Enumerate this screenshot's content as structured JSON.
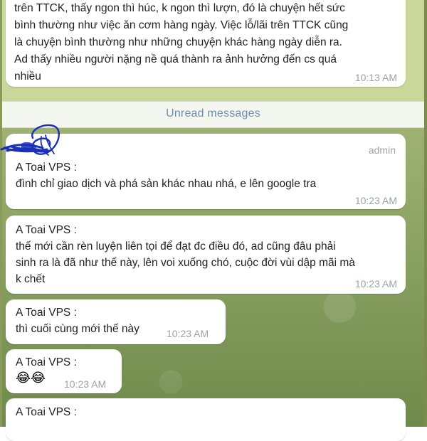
{
  "top_message": {
    "lines": [
      "trên TTCK, thấy ngon thì húc, k ngon thì lượn, đó là chuyện hết sức",
      "bình thường như việc ăn cơm hàng ngày. Việc lỗ/lãi trên TTCK cũng",
      "là chuyện bình thường như những chuyện khác hàng ngày diễn ra.",
      "Ad thấy nhiều người nặng nề quá thành ra ảnh hưởng đến cs quá",
      "nhiều"
    ],
    "time": "10:13 AM"
  },
  "unread_label": "Unread messages",
  "messages": [
    {
      "sender": "A Toai VPS :",
      "badge": "admin",
      "lines": [
        "đình chỉ giao dịch và phá sản khác nhau nhá, e lên google tra"
      ],
      "time": "10:23 AM"
    },
    {
      "sender": "A Toai VPS :",
      "lines": [
        "thế mới cần rèn luyện liên tọi để đạt đc điều đó, ad cũng đâu phải",
        "sinh ra là đã như thế này, lên voi xuống chó, cuộc đời vùi dập mãi mà",
        "k chết"
      ],
      "time": "10:23 AM"
    },
    {
      "sender": "A Toai VPS :",
      "lines": [
        "thì cuối cùng mới thế này"
      ],
      "time": "10:23 AM"
    },
    {
      "sender": "A Toai VPS :",
      "emoji": "😂😂",
      "time": "10:23 AM"
    },
    {
      "sender": "A Toai VPS :"
    }
  ],
  "colors": {
    "frame_top": "#c9d79a",
    "unread_text": "#6b8fb3",
    "chat_background": "#88a060",
    "bubble": "#ffffff",
    "timestamp": "#9aa2aa",
    "scribble": "#1c2fb8"
  }
}
